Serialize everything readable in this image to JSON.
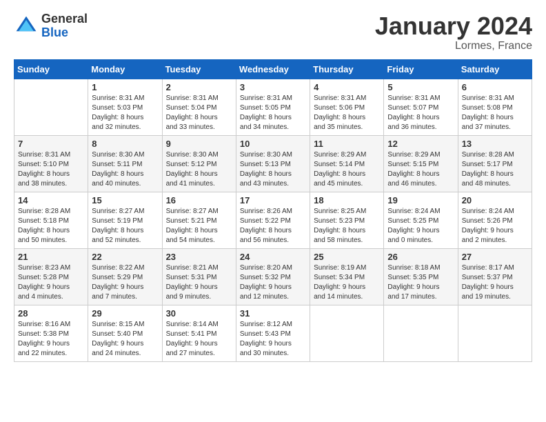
{
  "logo": {
    "general": "General",
    "blue": "Blue"
  },
  "title": "January 2024",
  "location": "Lormes, France",
  "days": [
    "Sunday",
    "Monday",
    "Tuesday",
    "Wednesday",
    "Thursday",
    "Friday",
    "Saturday"
  ],
  "weeks": [
    [
      {
        "day": "",
        "info": ""
      },
      {
        "day": "1",
        "info": "Sunrise: 8:31 AM\nSunset: 5:03 PM\nDaylight: 8 hours\nand 32 minutes."
      },
      {
        "day": "2",
        "info": "Sunrise: 8:31 AM\nSunset: 5:04 PM\nDaylight: 8 hours\nand 33 minutes."
      },
      {
        "day": "3",
        "info": "Sunrise: 8:31 AM\nSunset: 5:05 PM\nDaylight: 8 hours\nand 34 minutes."
      },
      {
        "day": "4",
        "info": "Sunrise: 8:31 AM\nSunset: 5:06 PM\nDaylight: 8 hours\nand 35 minutes."
      },
      {
        "day": "5",
        "info": "Sunrise: 8:31 AM\nSunset: 5:07 PM\nDaylight: 8 hours\nand 36 minutes."
      },
      {
        "day": "6",
        "info": "Sunrise: 8:31 AM\nSunset: 5:08 PM\nDaylight: 8 hours\nand 37 minutes."
      }
    ],
    [
      {
        "day": "7",
        "info": "Sunrise: 8:31 AM\nSunset: 5:10 PM\nDaylight: 8 hours\nand 38 minutes."
      },
      {
        "day": "8",
        "info": "Sunrise: 8:30 AM\nSunset: 5:11 PM\nDaylight: 8 hours\nand 40 minutes."
      },
      {
        "day": "9",
        "info": "Sunrise: 8:30 AM\nSunset: 5:12 PM\nDaylight: 8 hours\nand 41 minutes."
      },
      {
        "day": "10",
        "info": "Sunrise: 8:30 AM\nSunset: 5:13 PM\nDaylight: 8 hours\nand 43 minutes."
      },
      {
        "day": "11",
        "info": "Sunrise: 8:29 AM\nSunset: 5:14 PM\nDaylight: 8 hours\nand 45 minutes."
      },
      {
        "day": "12",
        "info": "Sunrise: 8:29 AM\nSunset: 5:15 PM\nDaylight: 8 hours\nand 46 minutes."
      },
      {
        "day": "13",
        "info": "Sunrise: 8:28 AM\nSunset: 5:17 PM\nDaylight: 8 hours\nand 48 minutes."
      }
    ],
    [
      {
        "day": "14",
        "info": "Sunrise: 8:28 AM\nSunset: 5:18 PM\nDaylight: 8 hours\nand 50 minutes."
      },
      {
        "day": "15",
        "info": "Sunrise: 8:27 AM\nSunset: 5:19 PM\nDaylight: 8 hours\nand 52 minutes."
      },
      {
        "day": "16",
        "info": "Sunrise: 8:27 AM\nSunset: 5:21 PM\nDaylight: 8 hours\nand 54 minutes."
      },
      {
        "day": "17",
        "info": "Sunrise: 8:26 AM\nSunset: 5:22 PM\nDaylight: 8 hours\nand 56 minutes."
      },
      {
        "day": "18",
        "info": "Sunrise: 8:25 AM\nSunset: 5:23 PM\nDaylight: 8 hours\nand 58 minutes."
      },
      {
        "day": "19",
        "info": "Sunrise: 8:24 AM\nSunset: 5:25 PM\nDaylight: 9 hours\nand 0 minutes."
      },
      {
        "day": "20",
        "info": "Sunrise: 8:24 AM\nSunset: 5:26 PM\nDaylight: 9 hours\nand 2 minutes."
      }
    ],
    [
      {
        "day": "21",
        "info": "Sunrise: 8:23 AM\nSunset: 5:28 PM\nDaylight: 9 hours\nand 4 minutes."
      },
      {
        "day": "22",
        "info": "Sunrise: 8:22 AM\nSunset: 5:29 PM\nDaylight: 9 hours\nand 7 minutes."
      },
      {
        "day": "23",
        "info": "Sunrise: 8:21 AM\nSunset: 5:31 PM\nDaylight: 9 hours\nand 9 minutes."
      },
      {
        "day": "24",
        "info": "Sunrise: 8:20 AM\nSunset: 5:32 PM\nDaylight: 9 hours\nand 12 minutes."
      },
      {
        "day": "25",
        "info": "Sunrise: 8:19 AM\nSunset: 5:34 PM\nDaylight: 9 hours\nand 14 minutes."
      },
      {
        "day": "26",
        "info": "Sunrise: 8:18 AM\nSunset: 5:35 PM\nDaylight: 9 hours\nand 17 minutes."
      },
      {
        "day": "27",
        "info": "Sunrise: 8:17 AM\nSunset: 5:37 PM\nDaylight: 9 hours\nand 19 minutes."
      }
    ],
    [
      {
        "day": "28",
        "info": "Sunrise: 8:16 AM\nSunset: 5:38 PM\nDaylight: 9 hours\nand 22 minutes."
      },
      {
        "day": "29",
        "info": "Sunrise: 8:15 AM\nSunset: 5:40 PM\nDaylight: 9 hours\nand 24 minutes."
      },
      {
        "day": "30",
        "info": "Sunrise: 8:14 AM\nSunset: 5:41 PM\nDaylight: 9 hours\nand 27 minutes."
      },
      {
        "day": "31",
        "info": "Sunrise: 8:12 AM\nSunset: 5:43 PM\nDaylight: 9 hours\nand 30 minutes."
      },
      {
        "day": "",
        "info": ""
      },
      {
        "day": "",
        "info": ""
      },
      {
        "day": "",
        "info": ""
      }
    ]
  ]
}
